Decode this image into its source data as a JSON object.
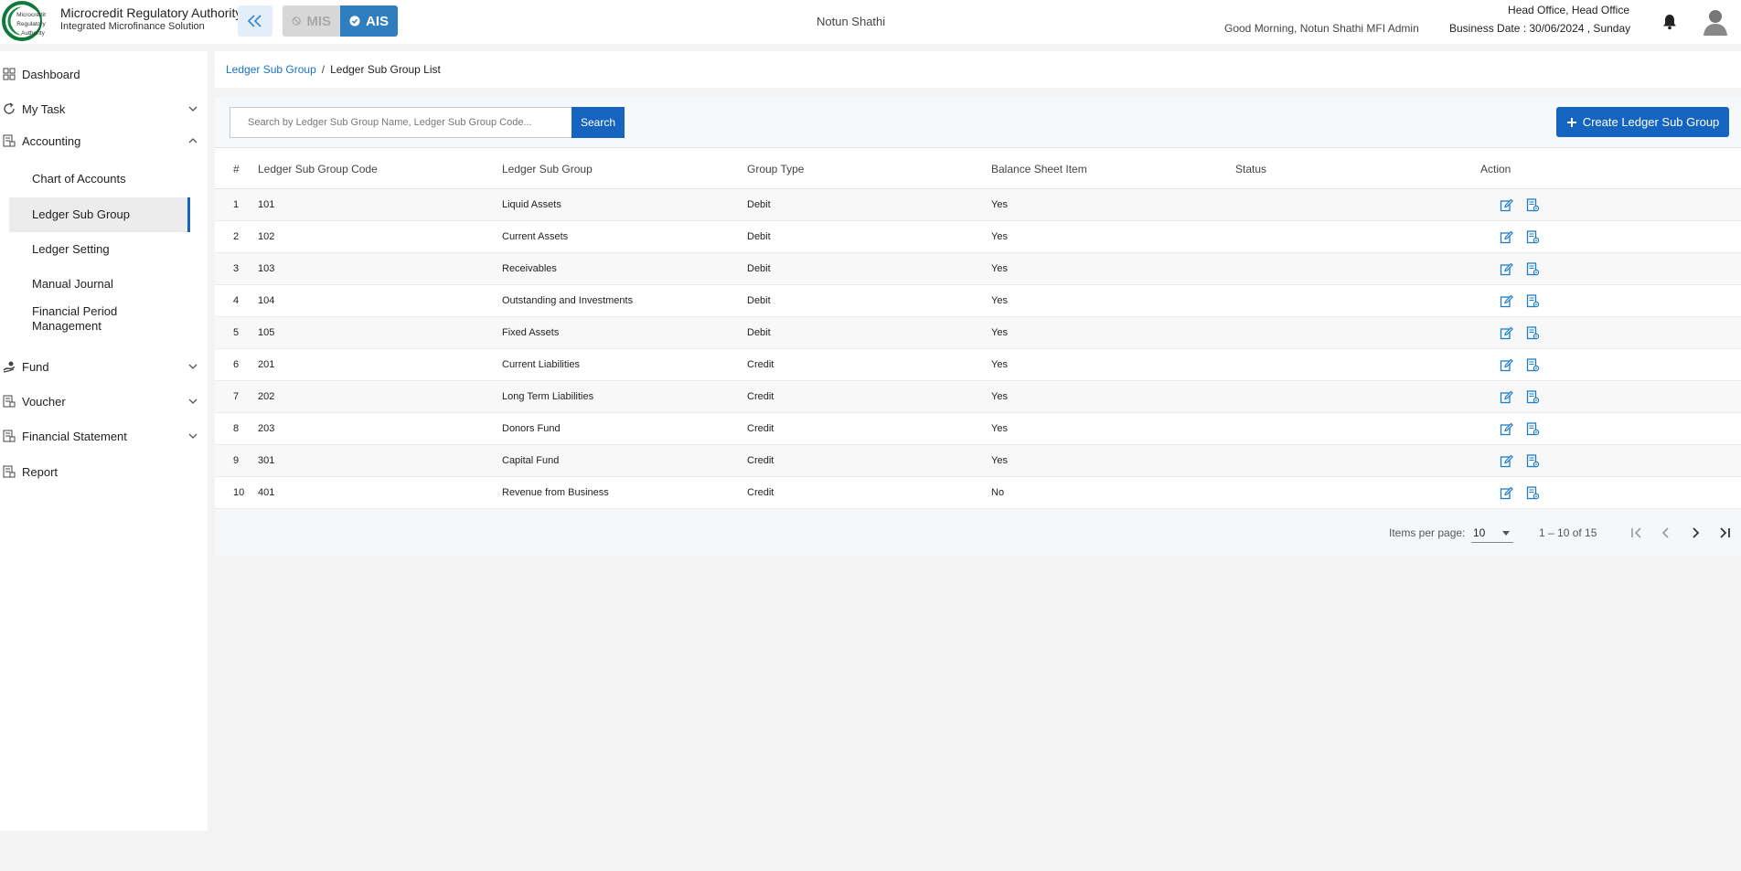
{
  "header": {
    "org_name": "Microcredit Regulatory Authority",
    "org_subtitle": "Integrated Microfinance Solution",
    "logo_text": [
      "Microcredit",
      "Regulatory",
      "Authority"
    ],
    "module_mis": "MIS",
    "module_ais": "AIS",
    "center_org": "Notun Shathi",
    "greeting": "Good Morning, Notun Shathi MFI Admin",
    "office": "Head Office, Head Office",
    "business_date": "Business Date : 30/06/2024 , Sunday"
  },
  "sidebar": {
    "items": [
      {
        "label": "Dashboard",
        "icon": "grid-icon"
      },
      {
        "label": "My Task",
        "icon": "refresh-icon"
      },
      {
        "label": "Accounting",
        "icon": "ledger-icon"
      },
      {
        "label": "Fund",
        "icon": "hand-coin-icon"
      },
      {
        "label": "Voucher",
        "icon": "ledger-icon"
      },
      {
        "label": "Financial Statement",
        "icon": "ledger-icon"
      },
      {
        "label": "Report",
        "icon": "ledger-icon"
      }
    ],
    "accounting_children": [
      {
        "label": "Chart of Accounts"
      },
      {
        "label": "Ledger Sub Group"
      },
      {
        "label": "Ledger Setting"
      },
      {
        "label": "Manual Journal"
      },
      {
        "label": "Financial Period Management"
      }
    ]
  },
  "breadcrumb": {
    "parent": "Ledger Sub Group",
    "separator": "/",
    "current": "Ledger Sub Group List"
  },
  "toolbar": {
    "search_placeholder": "Search by Ledger Sub Group Name, Ledger Sub Group Code...",
    "search_button": "Search",
    "create_button": "Create Ledger Sub Group"
  },
  "table": {
    "headers": {
      "index": "#",
      "code": "Ledger Sub Group Code",
      "name": "Ledger Sub Group",
      "type": "Group Type",
      "balance": "Balance Sheet Item",
      "status": "Status",
      "action": "Action"
    },
    "rows": [
      {
        "index": "1",
        "code": "101",
        "name": "Liquid Assets",
        "type": "Debit",
        "balance": "Yes",
        "status": ""
      },
      {
        "index": "2",
        "code": "102",
        "name": "Current Assets",
        "type": "Debit",
        "balance": "Yes",
        "status": ""
      },
      {
        "index": "3",
        "code": "103",
        "name": "Receivables",
        "type": "Debit",
        "balance": "Yes",
        "status": ""
      },
      {
        "index": "4",
        "code": "104",
        "name": "Outstanding and Investments",
        "type": "Debit",
        "balance": "Yes",
        "status": ""
      },
      {
        "index": "5",
        "code": "105",
        "name": "Fixed Assets",
        "type": "Debit",
        "balance": "Yes",
        "status": ""
      },
      {
        "index": "6",
        "code": "201",
        "name": "Current Liabilities",
        "type": "Credit",
        "balance": "Yes",
        "status": ""
      },
      {
        "index": "7",
        "code": "202",
        "name": "Long Term Liabilities",
        "type": "Credit",
        "balance": "Yes",
        "status": ""
      },
      {
        "index": "8",
        "code": "203",
        "name": "Donors Fund",
        "type": "Credit",
        "balance": "Yes",
        "status": ""
      },
      {
        "index": "9",
        "code": "301",
        "name": "Capital Fund",
        "type": "Credit",
        "balance": "Yes",
        "status": ""
      },
      {
        "index": "10",
        "code": "401",
        "name": "Revenue from Business",
        "type": "Credit",
        "balance": "No",
        "status": ""
      }
    ]
  },
  "paginator": {
    "label": "Items per page:",
    "page_size": "10",
    "range": "1 – 10 of 15"
  },
  "colors": {
    "primary": "#1565c0",
    "ais_active": "#2f7fc0",
    "link": "#1a73c8",
    "logo_green": "#0b7a3b"
  }
}
